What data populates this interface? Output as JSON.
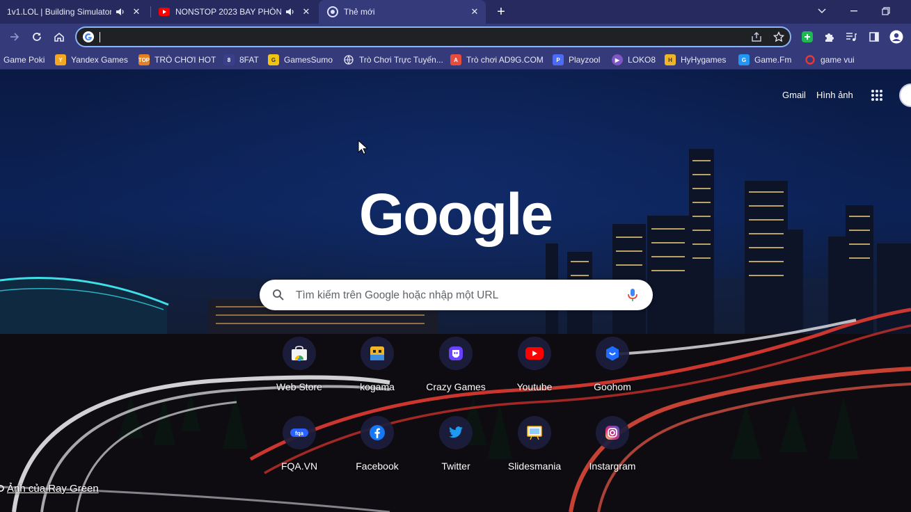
{
  "tabs": [
    {
      "title": "1v1.LOL | Building Simulator,",
      "audio": true,
      "favicon": "game-icon"
    },
    {
      "title": "NONSTOP 2023 BAY PHÒNG",
      "audio": true,
      "favicon": "youtube-icon"
    },
    {
      "title": "Thẻ mới",
      "audio": false,
      "favicon": "chrome-icon",
      "active": true
    }
  ],
  "omnibox": {
    "value": "",
    "site_icon": "google-icon"
  },
  "bookmarks": [
    {
      "label": "Game Poki",
      "icon": "poki-icon",
      "color": "#2d6cdf"
    },
    {
      "label": "Yandex Games",
      "icon": "yandex-icon",
      "color": "#f5a623"
    },
    {
      "label": "TRÒ CHƠI HOT",
      "icon": "top-icon",
      "color": "#e67e22"
    },
    {
      "label": "8FAT",
      "icon": "8fat-icon",
      "color": "#5b6bd6"
    },
    {
      "label": "GamesSumo",
      "icon": "gamessumo-icon",
      "color": "#f1c40f"
    },
    {
      "label": "Trò Chơi Trực Tuyến...",
      "icon": "globe-icon",
      "color": "#9e9e9e"
    },
    {
      "label": "Trò chơi AD9G.COM",
      "icon": "ad9g-icon",
      "color": "#e74c3c"
    },
    {
      "label": "Playzool",
      "icon": "playzool-icon",
      "color": "#4a6cf7"
    },
    {
      "label": "LOKO8",
      "icon": "loko8-icon",
      "color": "#7e57c2"
    },
    {
      "label": "HyHygames",
      "icon": "hyhygames-icon",
      "color": "#f0b429"
    },
    {
      "label": "Game.Fm",
      "icon": "gamefm-icon",
      "color": "#2196f3"
    },
    {
      "label": "game vui",
      "icon": "gamevui-icon",
      "color": "#e53935"
    }
  ],
  "header_links": {
    "gmail": "Gmail",
    "images": "Hình ảnh"
  },
  "logo": "Google",
  "search": {
    "placeholder": "Tìm kiếm trên Google hoặc nhập một URL"
  },
  "shortcuts": [
    {
      "label": "Web Store",
      "icon": "web-store-icon",
      "color": "#e53935"
    },
    {
      "label": "kogama",
      "icon": "kogama-icon",
      "color": "#f0b429"
    },
    {
      "label": "Crazy Games",
      "icon": "crazy-games-icon",
      "color": "#6842ff"
    },
    {
      "label": "Youtube",
      "icon": "youtube-icon",
      "color": "#ff0000"
    },
    {
      "label": "Goohom",
      "icon": "goohom-icon",
      "color": "#1e6bff"
    },
    {
      "label": "FQA.VN",
      "icon": "fqa-icon",
      "color": "#2962ff"
    },
    {
      "label": "Facebook",
      "icon": "facebook-icon",
      "color": "#1877f2"
    },
    {
      "label": "Twitter",
      "icon": "twitter-icon",
      "color": "#1d9bf0"
    },
    {
      "label": "Slidesmania",
      "icon": "slidesmania-icon",
      "color": "#ffb300"
    },
    {
      "label": "Instargram",
      "icon": "instagram-icon",
      "color": "#d62976"
    }
  ],
  "credit": {
    "text": "Ảnh của Ray Green"
  }
}
